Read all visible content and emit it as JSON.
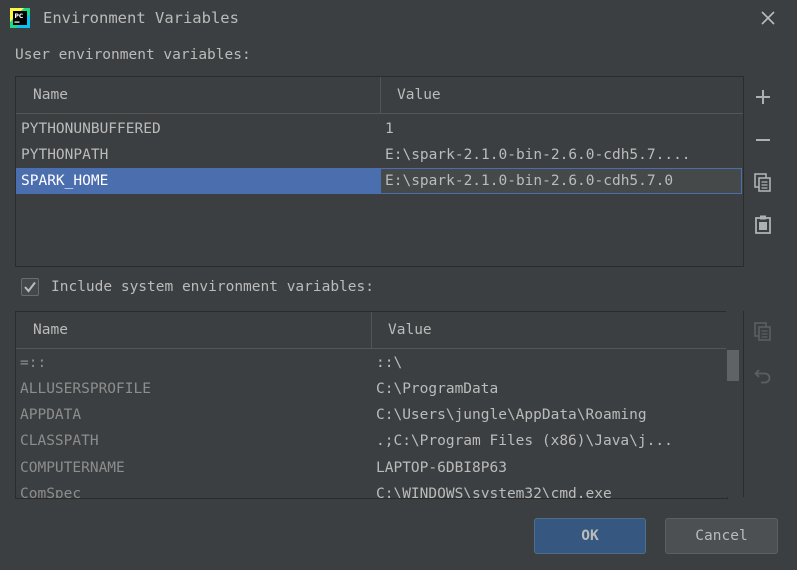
{
  "window": {
    "title": "Environment Variables",
    "logo_text": "PC"
  },
  "user_section": {
    "label": "User environment variables:",
    "columns": {
      "name": "Name",
      "value": "Value"
    },
    "rows": [
      {
        "name": "PYTHONUNBUFFERED",
        "value": "1"
      },
      {
        "name": "PYTHONPATH",
        "value": "E:\\spark-2.1.0-bin-2.6.0-cdh5.7...."
      },
      {
        "name": "SPARK_HOME",
        "value": "E:\\spark-2.1.0-bin-2.6.0-cdh5.7.0",
        "selected": true
      }
    ],
    "toolbar": [
      "add-icon",
      "remove-icon",
      "copy-icon",
      "paste-icon"
    ]
  },
  "system_section": {
    "checkbox_label": "Include system environment variables:",
    "checked": true,
    "columns": {
      "name": "Name",
      "value": "Value"
    },
    "rows": [
      {
        "name": "=::",
        "value": "::\\"
      },
      {
        "name": "ALLUSERSPROFILE",
        "value": "C:\\ProgramData"
      },
      {
        "name": "APPDATA",
        "value": "C:\\Users\\jungle\\AppData\\Roaming"
      },
      {
        "name": "CLASSPATH",
        "value": ".;C:\\Program Files (x86)\\Java\\j..."
      },
      {
        "name": "COMPUTERNAME",
        "value": "LAPTOP-6DBI8P63"
      },
      {
        "name": "ComSpec",
        "value": "C:\\WINDOWS\\system32\\cmd.exe"
      }
    ],
    "toolbar": [
      "copy-icon",
      "undo-icon"
    ]
  },
  "buttons": {
    "ok": "OK",
    "cancel": "Cancel"
  },
  "colors": {
    "background": "#3c3f41",
    "selection": "#4b6eaf",
    "ok_button": "#365880"
  }
}
